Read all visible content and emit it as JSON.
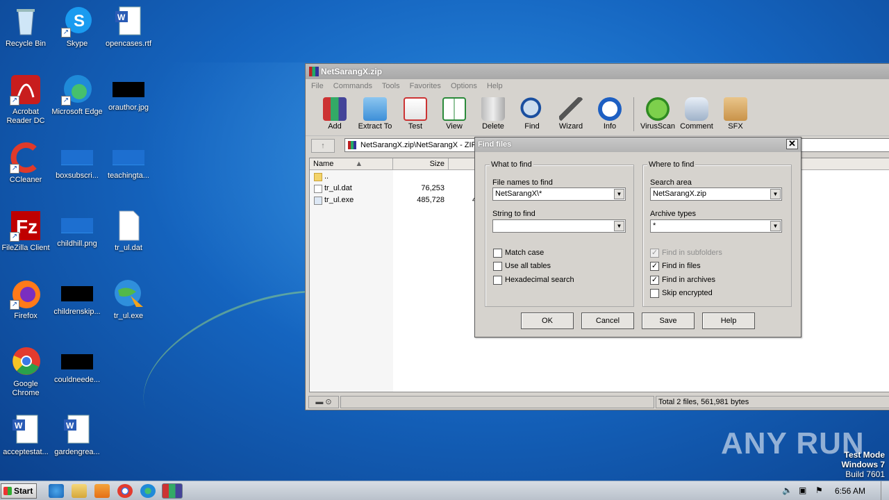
{
  "desktop": {
    "icons": [
      {
        "label": "Recycle Bin",
        "icon": "recycle-bin-icon"
      },
      {
        "label": "Skype",
        "icon": "skype-icon"
      },
      {
        "label": "opencases.rtf",
        "icon": "word-document-icon"
      },
      {
        "label": "Acrobat Reader DC",
        "icon": "acrobat-icon"
      },
      {
        "label": "Microsoft Edge",
        "icon": "edge-icon"
      },
      {
        "label": "orauthor.jpg",
        "icon": "image-file-icon"
      },
      {
        "label": "CCleaner",
        "icon": "ccleaner-icon"
      },
      {
        "label": "boxsubscri...",
        "icon": "image-file-icon"
      },
      {
        "label": "teachingta...",
        "icon": "image-file-icon"
      },
      {
        "label": "FileZilla Client",
        "icon": "filezilla-icon"
      },
      {
        "label": "childhill.png",
        "icon": "image-file-icon"
      },
      {
        "label": "tr_ul.dat",
        "icon": "blank-file-icon"
      },
      {
        "label": "Firefox",
        "icon": "firefox-icon"
      },
      {
        "label": "childrenskip...",
        "icon": "image-file-icon"
      },
      {
        "label": "tr_ul.exe",
        "icon": "exe-globe-icon"
      },
      {
        "label": "Google Chrome",
        "icon": "chrome-icon"
      },
      {
        "label": "couldneede...",
        "icon": "image-file-icon"
      },
      {
        "label": "acceptestat...",
        "icon": "word-document-icon"
      },
      {
        "label": "gardengrea...",
        "icon": "word-document-icon"
      }
    ]
  },
  "winrar": {
    "title": "NetSarangX.zip",
    "menu": [
      "File",
      "Commands",
      "Tools",
      "Favorites",
      "Options",
      "Help"
    ],
    "toolbar": [
      "Add",
      "Extract To",
      "Test",
      "View",
      "Delete",
      "Find",
      "Wizard",
      "Info",
      "VirusScan",
      "Comment",
      "SFX"
    ],
    "address": "NetSarangX.zip\\NetSarangX - ZIP",
    "columns": {
      "name": "Name",
      "size": "Size"
    },
    "files": [
      {
        "name": "..",
        "size": ""
      },
      {
        "name": "tr_ul.dat",
        "size": "76,253",
        "extra": ""
      },
      {
        "name": "tr_ul.exe",
        "size": "485,728",
        "extra": "4"
      }
    ],
    "status": "Total 2 files, 561,981 bytes"
  },
  "find_dialog": {
    "title": "Find files",
    "what_group": "What to find",
    "file_names_label": "File names to find",
    "file_names_value": "NetSarangX\\*",
    "string_label": "String to find",
    "string_value": "",
    "match_case": {
      "label": "Match case",
      "checked": false
    },
    "use_all_tables": {
      "label": "Use all tables",
      "checked": false
    },
    "hex_search": {
      "label": "Hexadecimal search",
      "checked": false
    },
    "where_group": "Where to find",
    "search_area_label": "Search area",
    "search_area_value": "NetSarangX.zip",
    "archive_types_label": "Archive types",
    "archive_types_value": "*",
    "find_in_subfolders": {
      "label": "Find in subfolders",
      "checked": true,
      "disabled": true
    },
    "find_in_files": {
      "label": "Find in files",
      "checked": true
    },
    "find_in_archives": {
      "label": "Find in archives",
      "checked": true
    },
    "skip_encrypted": {
      "label": "Skip encrypted",
      "checked": false
    },
    "buttons": {
      "ok": "OK",
      "cancel": "Cancel",
      "save": "Save",
      "help": "Help"
    }
  },
  "taskbar": {
    "start": "Start",
    "clock": "6:56 AM"
  },
  "watermark": "ANY RUN",
  "test_mode": {
    "line1": "Test Mode",
    "line2": "Windows 7",
    "line3": "Build 7601"
  }
}
